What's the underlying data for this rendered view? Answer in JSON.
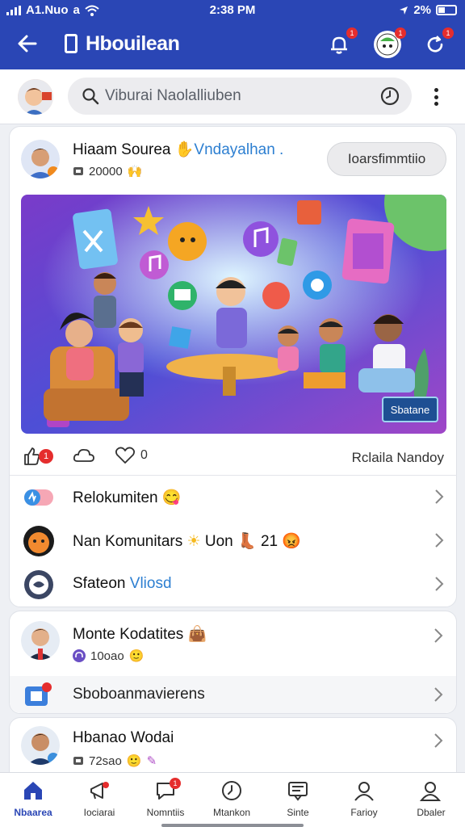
{
  "status_bar": {
    "carrier": "A1.Nuo",
    "carrier_suffix": "a",
    "time": "2:38 PM",
    "battery": "2%"
  },
  "app_bar": {
    "title": "Hbouilean",
    "badges": [
      "1",
      "1",
      "1"
    ]
  },
  "search": {
    "placeholder": "Viburai Naolalliuben"
  },
  "post": {
    "author": "Hiaam Sourea",
    "author_link": "Vndayalhan .",
    "meta_count": "20000",
    "follow_label": "Ioarsfimmtiio",
    "hero_button": "Sbatane",
    "like_badge": "1",
    "comment_count": "0",
    "footer_text": "Rclaila Nandoy"
  },
  "list_items": [
    {
      "label": "Relokumiten"
    },
    {
      "label": "Nan Komunitars",
      "extra": "Uon",
      "extra_num": "21"
    },
    {
      "label": "Sfateon",
      "link": "Vliosd"
    }
  ],
  "community": {
    "name": "Monte Kodatites",
    "count": "10oao",
    "sub_label": "Sboboanmavierens"
  },
  "community2": {
    "name": "Hbanao Wodai",
    "count": "72sao"
  },
  "bottom_nav": [
    {
      "label": "Nbaarea",
      "active": true
    },
    {
      "label": "Iociarai"
    },
    {
      "label": "Nomntiis",
      "badge": "1"
    },
    {
      "label": "Mtankon"
    },
    {
      "label": "Sinte"
    },
    {
      "label": "Farioy"
    },
    {
      "label": "Dbaler"
    }
  ],
  "colors": {
    "brand": "#2a46b5",
    "accent_link": "#2d7fd1",
    "badge": "#e52d2d"
  }
}
